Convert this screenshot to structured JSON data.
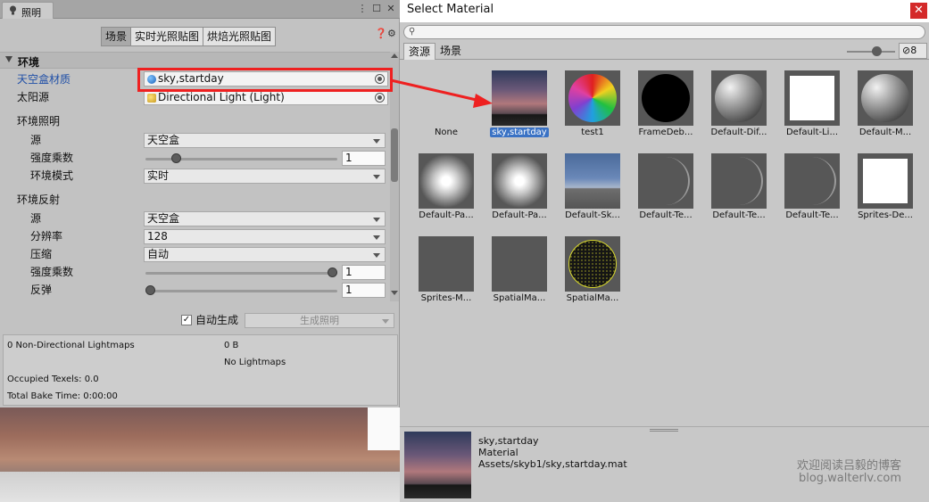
{
  "lighting": {
    "tab_title": "照明",
    "modes": [
      "场景",
      "实时光照贴图",
      "烘焙光照贴图"
    ],
    "section": "环境",
    "skybox_label": "天空盒材质",
    "skybox_value": "sky,startday",
    "sun_label": "太阳源",
    "sun_value": "Directional Light (Light)",
    "env_lighting_header": "环境照明",
    "src_label": "源",
    "src_value": "天空盒",
    "intensity_label": "强度乘数",
    "intensity_value": "1",
    "intensity_fraction": 0.14,
    "env_mode_label": "环境模式",
    "env_mode_value": "实时",
    "env_reflect_header": "环境反射",
    "refl_src_label": "源",
    "refl_src_value": "天空盒",
    "resolution_label": "分辨率",
    "resolution_value": "128",
    "compression_label": "压缩",
    "compression_value": "自动",
    "refl_intensity_label": "强度乘数",
    "refl_intensity_value": "1",
    "refl_intensity_fraction": 1.0,
    "bounces_label": "反弹",
    "bounces_value": "1",
    "bounces_fraction": 0.0,
    "auto_generate_label": "自动生成",
    "auto_generate_check": "✓",
    "generate_button": "生成照明",
    "stats": {
      "lightmaps": "0 Non-Directional Lightmaps",
      "size": "0 B",
      "no_lightmaps": "No Lightmaps",
      "texels": "Occupied Texels: 0.0",
      "bake_time": "Total Bake Time: 0:00:00"
    }
  },
  "select_material": {
    "title": "Select Material",
    "close": "✕",
    "tabs": [
      "资源",
      "场景"
    ],
    "hidden_count": "8",
    "items": [
      {
        "label": "None"
      },
      {
        "label": "sky,startday"
      },
      {
        "label": "test1"
      },
      {
        "label": "FrameDeb..."
      },
      {
        "label": "Default-Dif..."
      },
      {
        "label": "Default-Li..."
      },
      {
        "label": "Default-M..."
      },
      {
        "label": "Default-Pa..."
      },
      {
        "label": "Default-Pa..."
      },
      {
        "label": "Default-Sk..."
      },
      {
        "label": "Default-Te..."
      },
      {
        "label": "Default-Te..."
      },
      {
        "label": "Default-Te..."
      },
      {
        "label": "Sprites-De..."
      },
      {
        "label": "Sprites-M..."
      },
      {
        "label": "SpatialMa..."
      },
      {
        "label": "SpatialMa..."
      }
    ],
    "selected_index": 1,
    "info": {
      "name": "sky,startday",
      "type": "Material",
      "path": "Assets/skyb1/sky,startday.mat"
    },
    "watermark_line1": "欢迎阅读吕毅的博客",
    "watermark_line2": "blog.walterlv.com"
  },
  "colors": {
    "highlight_red": "#ee2020",
    "selection_blue": "#3a72c4",
    "label_blue": "#1f4fa7"
  }
}
